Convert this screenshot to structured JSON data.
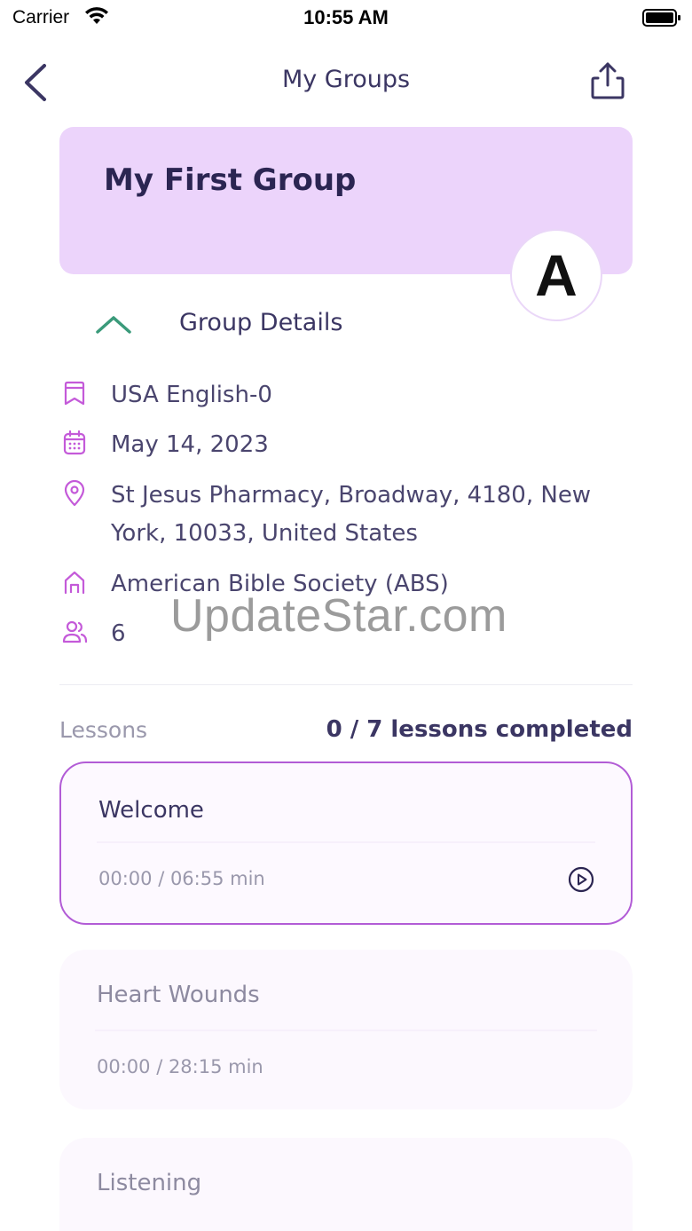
{
  "status_bar": {
    "carrier": "Carrier",
    "time": "10:55 AM"
  },
  "nav": {
    "title": "My Groups",
    "back_icon": "chevron-left-icon",
    "share_icon": "share-icon"
  },
  "group": {
    "name": "My First Group",
    "avatar_letter": "A"
  },
  "details": {
    "toggle_label": "Group Details",
    "language": "USA English-0",
    "date": "May 14, 2023",
    "location": "St Jesus Pharmacy, Broadway, 4180, New York, 10033, United States",
    "organization": "American Bible Society (ABS)",
    "members": "6"
  },
  "watermark": "UpdateStar.com",
  "lessons": {
    "label": "Lessons",
    "progress": "0 / 7 lessons completed",
    "items": [
      {
        "title": "Welcome",
        "time": "00:00 / 06:55 min"
      },
      {
        "title": "Heart Wounds",
        "time": "00:00 / 28:15 min"
      },
      {
        "title": "Listening",
        "time": ""
      }
    ]
  },
  "colors": {
    "accent": "#b25cd6",
    "card": "#ecd4fb",
    "text": "#3b3663",
    "icon": "#c45ad9",
    "chevron": "#3a9a7a"
  }
}
